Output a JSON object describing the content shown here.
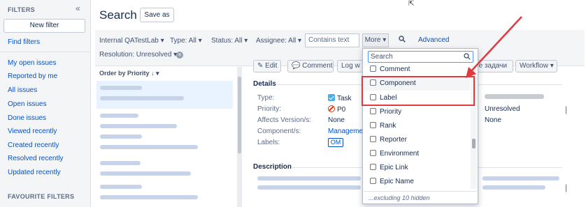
{
  "sidebar": {
    "header": "FILTERS",
    "new_filter_label": "New filter",
    "find_filters": "Find filters",
    "items": [
      {
        "label": "My open issues"
      },
      {
        "label": "Reported by me"
      },
      {
        "label": "All issues"
      },
      {
        "label": "Open issues"
      },
      {
        "label": "Done issues"
      },
      {
        "label": "Viewed recently"
      },
      {
        "label": "Created recently"
      },
      {
        "label": "Resolved recently"
      },
      {
        "label": "Updated recently"
      }
    ],
    "favourites_header": "FAVOURITE FILTERS"
  },
  "header": {
    "title": "Search",
    "save_as_label": "Save as"
  },
  "filters": {
    "project": "Internal QATestLab ▾",
    "type": "Type: All ▾",
    "status": "Status: All ▾",
    "assignee": "Assignee: All ▾",
    "contains_placeholder": "Contains text",
    "more_label": "More ▾",
    "advanced_label": "Advanced",
    "resolution": "Resolution: Unresolved ▾"
  },
  "list": {
    "order_label": "Order by Priority ↓ ▾"
  },
  "issue": {
    "toolbar": {
      "edit": "✎ Edit",
      "comment": "💬 Comment",
      "log_work": "Log w",
      "more_tasks": "ие задачи",
      "workflow": "Workflow ▾"
    },
    "details_title": "Details",
    "fields": [
      {
        "label": "Type:",
        "value": "Task"
      },
      {
        "label": "Priority:",
        "value": "P0"
      },
      {
        "label": "Affects Version/s:",
        "value": "None"
      },
      {
        "label": "Component/s:",
        "value": "Managemen"
      },
      {
        "label": "Labels:",
        "value": "OM"
      }
    ],
    "resolution_value": "Unresolved",
    "fix_version_value": "None",
    "description_title": "Description"
  },
  "dropdown": {
    "search_placeholder": "Search",
    "options": [
      {
        "label": "Comment"
      },
      {
        "label": "Component"
      },
      {
        "label": "Label"
      },
      {
        "label": "Priority"
      },
      {
        "label": "Rank"
      },
      {
        "label": "Reporter"
      },
      {
        "label": "Environment"
      },
      {
        "label": "Epic Link"
      },
      {
        "label": "Epic Name"
      }
    ],
    "footer": "...excluding 10 hidden"
  },
  "annotation": {
    "color": "#e0393e"
  }
}
